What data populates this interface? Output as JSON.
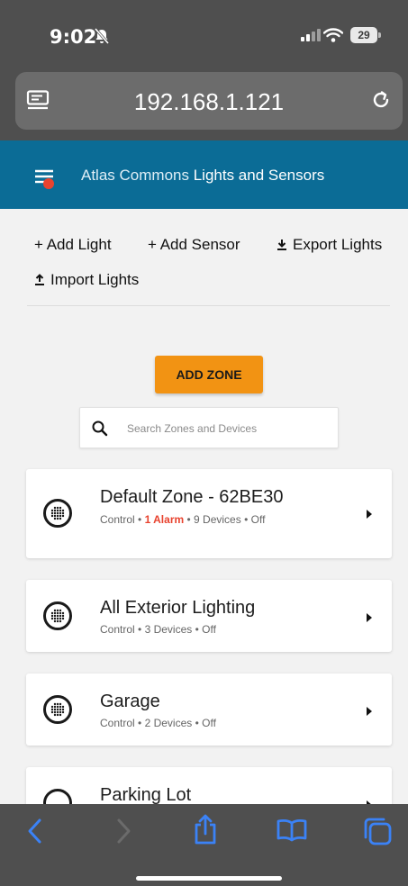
{
  "status_bar": {
    "time": "9:02",
    "battery": "29"
  },
  "browser": {
    "url": "192.168.1.121"
  },
  "app": {
    "title_prefix": "Atlas Commons",
    "title_main": "Lights and Sensors"
  },
  "actions": {
    "add_light": "+ Add Light",
    "add_sensor": "+ Add Sensor",
    "export_lights": "Export Lights",
    "import_lights": "Import Lights"
  },
  "add_zone_label": "ADD ZONE",
  "search": {
    "placeholder": "Search Zones and Devices"
  },
  "zones": [
    {
      "name": "Default Zone - 62BE30",
      "type": "Control",
      "alarm": "1 Alarm",
      "devices": "9 Devices",
      "state": "Off"
    },
    {
      "name": "All Exterior Lighting",
      "type": "Control",
      "devices": "3 Devices",
      "state": "Off"
    },
    {
      "name": "Garage",
      "type": "Control",
      "devices": "2 Devices",
      "state": "Off"
    },
    {
      "name": "Parking Lot"
    }
  ],
  "separator": "•",
  "colors": {
    "appbar": "#0b6c96",
    "accent": "#f29313",
    "alarm": "#e8432f",
    "chrome": "#4f4f4f",
    "ios_blue": "#3b82f6"
  }
}
